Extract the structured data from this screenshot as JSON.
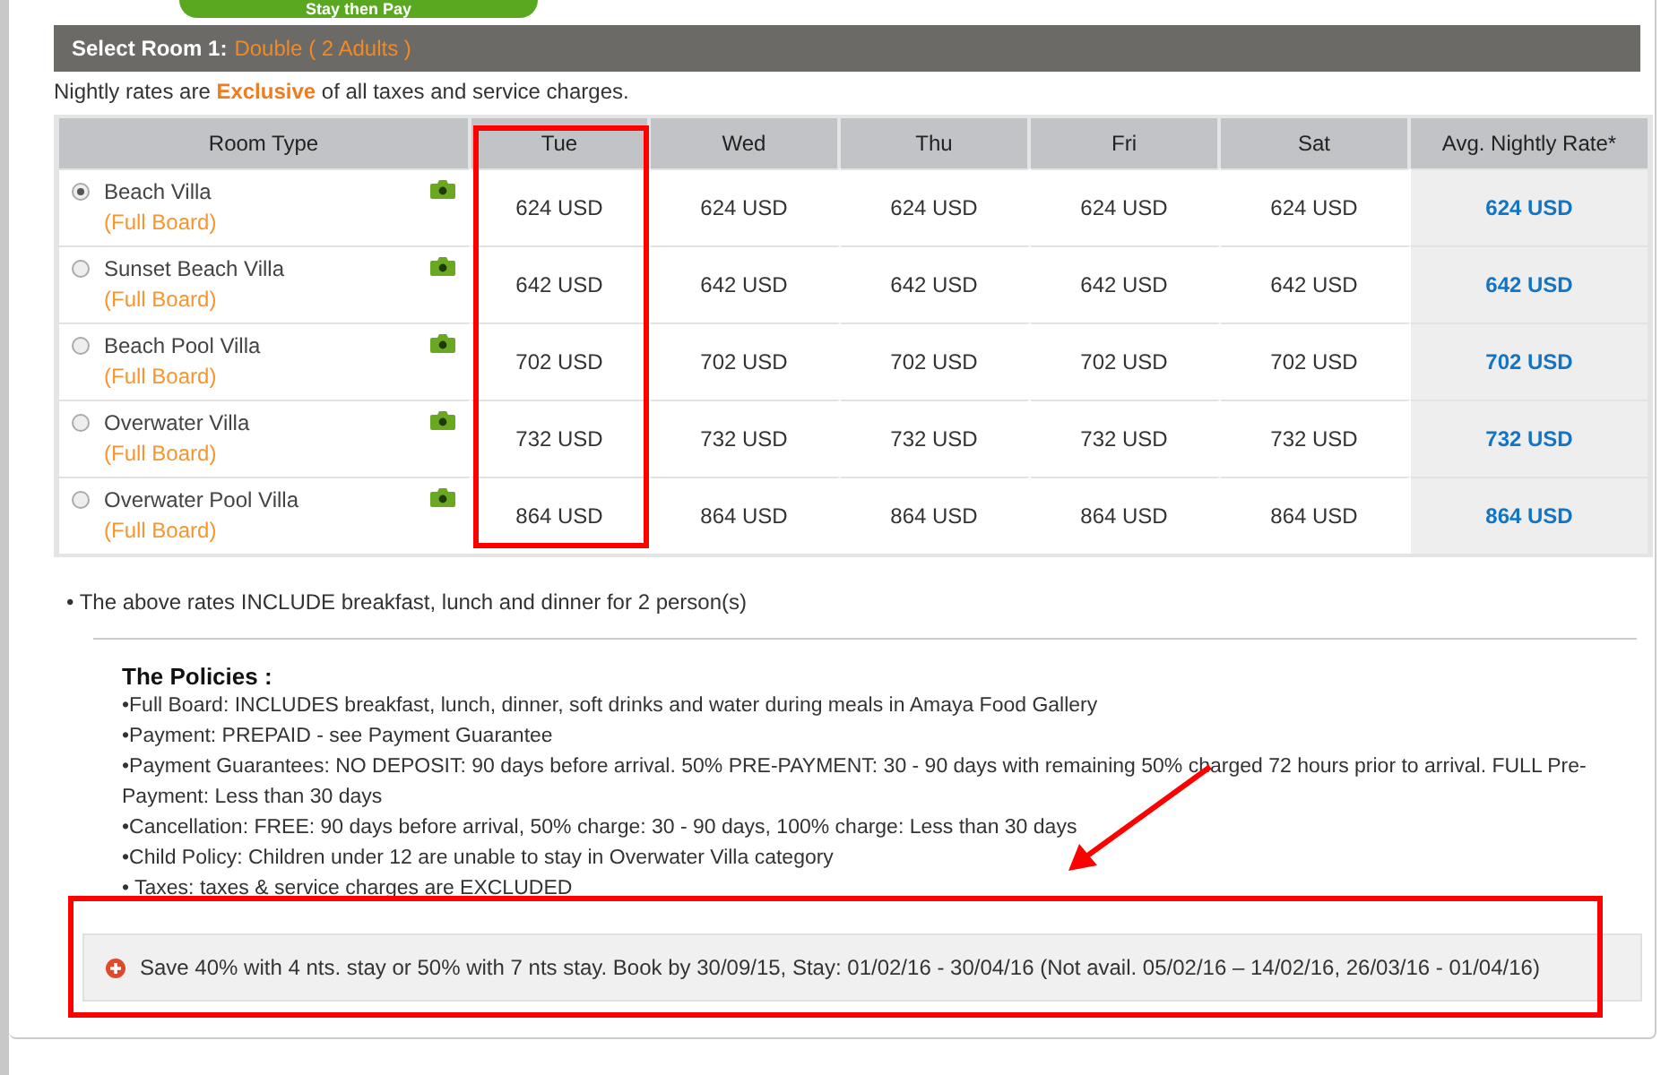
{
  "top_tab": {
    "label": "Stay then Pay"
  },
  "header": {
    "label": "Select Room 1:",
    "room": "Double ( 2 Adults )"
  },
  "rates_note": "Nightly rates are **Exclusive** of all taxes and service charges.",
  "table": {
    "columns": [
      "Room Type",
      "Tue",
      "Wed",
      "Thu",
      "Fri",
      "Sat",
      "Avg. Nightly Rate*"
    ],
    "rows": [
      {
        "name": "Beach Villa",
        "board": "(Full Board)",
        "selected": true,
        "rates": [
          "624 USD",
          "624 USD",
          "624 USD",
          "624 USD",
          "624 USD"
        ],
        "avg": "624 USD"
      },
      {
        "name": "Sunset Beach Villa",
        "board": "(Full Board)",
        "selected": false,
        "rates": [
          "642 USD",
          "642 USD",
          "642 USD",
          "642 USD",
          "642 USD"
        ],
        "avg": "642 USD"
      },
      {
        "name": "Beach Pool Villa",
        "board": "(Full Board)",
        "selected": false,
        "rates": [
          "702 USD",
          "702 USD",
          "702 USD",
          "702 USD",
          "702 USD"
        ],
        "avg": "702 USD"
      },
      {
        "name": "Overwater Villa",
        "board": "(Full Board)",
        "selected": false,
        "rates": [
          "732 USD",
          "732 USD",
          "732 USD",
          "732 USD",
          "732 USD"
        ],
        "avg": "732 USD"
      },
      {
        "name": "Overwater Pool Villa",
        "board": "(Full Board)",
        "selected": false,
        "rates": [
          "864 USD",
          "864 USD",
          "864 USD",
          "864 USD",
          "864 USD"
        ],
        "avg": "864 USD"
      }
    ]
  },
  "include_note": "• The above rates INCLUDE breakfast, lunch and dinner for 2 person(s)",
  "policies": {
    "title": "The Policies :",
    "items": [
      "•Full Board: INCLUDES breakfast, lunch, dinner, soft drinks and water during meals in Amaya Food Gallery",
      "•Payment: PREPAID - see Payment Guarantee",
      "•Payment Guarantees: NO DEPOSIT: 90 days before arrival. 50% PRE-PAYMENT: 30 - 90 days with remaining 50% charged 72 hours prior to arrival. FULL Pre-Payment: Less than 30 days",
      "•Cancellation: FREE: 90 days before arrival, 50% charge: 30 - 90 days, 100% charge: Less than 30 days",
      "•Child Policy: Children under 12 are unable to stay in Overwater Villa category",
      "• Taxes: taxes & service charges are EXCLUDED"
    ]
  },
  "promo": "Save 40% with 4 nts. stay or 50% with 7 nts stay. Book by 30/09/15, Stay: 01/02/16 - 30/04/16 (Not avail. 05/02/16 – 14/02/16, 26/03/16 - 01/04/16)"
}
